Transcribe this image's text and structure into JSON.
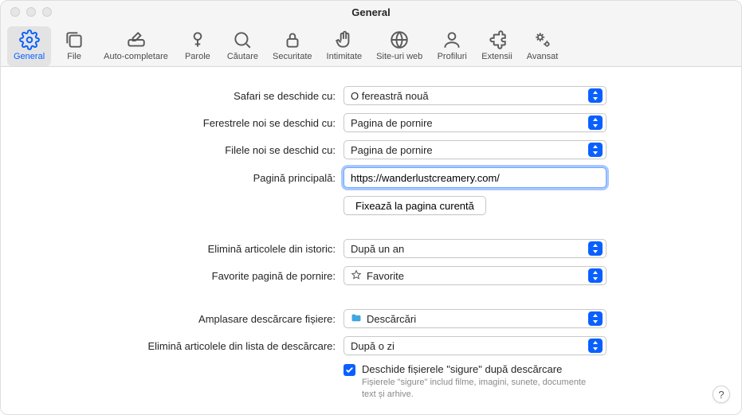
{
  "window": {
    "title": "General"
  },
  "toolbar": {
    "items": [
      {
        "id": "general",
        "label": "General"
      },
      {
        "id": "file",
        "label": "File"
      },
      {
        "id": "autofill",
        "label": "Auto-completare"
      },
      {
        "id": "passwords",
        "label": "Parole"
      },
      {
        "id": "search",
        "label": "Căutare"
      },
      {
        "id": "security",
        "label": "Securitate"
      },
      {
        "id": "privacy",
        "label": "Intimitate"
      },
      {
        "id": "websites",
        "label": "Site-uri web"
      },
      {
        "id": "profiles",
        "label": "Profiluri"
      },
      {
        "id": "extensions",
        "label": "Extensii"
      },
      {
        "id": "advanced",
        "label": "Avansat"
      }
    ],
    "selected": "general"
  },
  "labels": {
    "safari_opens_with": "Safari se deschide cu:",
    "new_windows_open_with": "Ferestrele noi se deschid cu:",
    "new_tabs_open_with": "Filele noi se deschid cu:",
    "homepage": "Pagină principală:",
    "remove_history": "Elimină articolele din istoric:",
    "favorites_start": "Favorite pagină de pornire:",
    "download_location": "Amplasare descărcare fișiere:",
    "remove_downloads": "Elimină articolele din lista de descărcare:"
  },
  "values": {
    "safari_opens_with": "O fereastră nouă",
    "new_windows_open_with": "Pagina de pornire",
    "new_tabs_open_with": "Pagina de pornire",
    "homepage": "https://wanderlustcreamery.com/",
    "set_current_page": "Fixează la pagina curentă",
    "remove_history": "După un an",
    "favorites_start": "Favorite",
    "download_location": "Descărcări",
    "remove_downloads": "După o zi",
    "open_safe_label": "Deschide fișierele \"sigure\" după descărcare",
    "open_safe_sub": "Fișierele \"sigure\" includ filme, imagini, sunete, documente text și arhive.",
    "open_safe_checked": true
  },
  "help_button": "?"
}
